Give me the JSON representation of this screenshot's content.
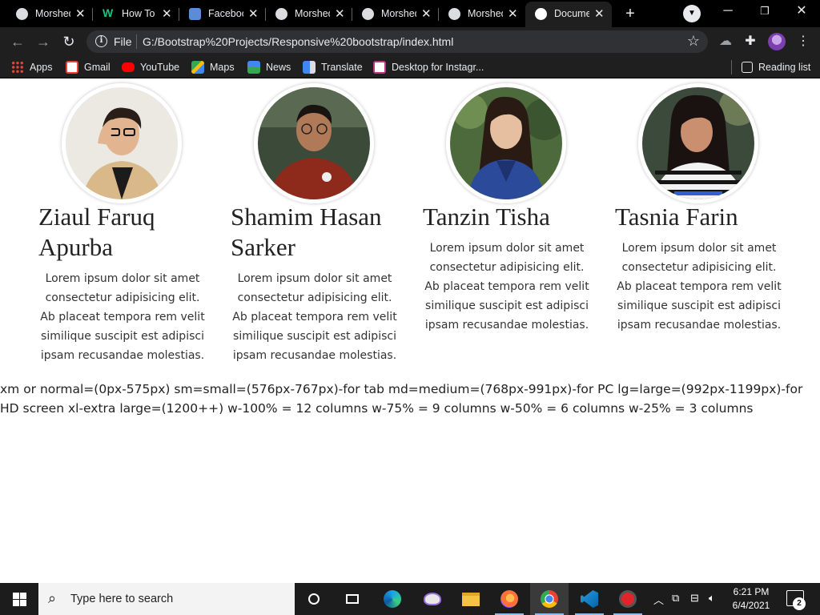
{
  "browser": {
    "tabs": [
      {
        "title": "Morshed",
        "active": false
      },
      {
        "title": "How To",
        "active": false
      },
      {
        "title": "Facebook",
        "active": false
      },
      {
        "title": "Morshed",
        "active": false
      },
      {
        "title": "Morshed",
        "active": false
      },
      {
        "title": "Morshed",
        "active": false
      },
      {
        "title": "Document",
        "active": true
      }
    ],
    "new_tab": "+",
    "address": {
      "scheme_label": "File",
      "url": "G:/Bootstrap%20Projects/Responsive%20bootstrap/index.html"
    },
    "bookmarks": [
      "Apps",
      "Gmail",
      "YouTube",
      "Maps",
      "News",
      "Translate",
      "Desktop for Instagr..."
    ],
    "reading_list": "Reading list"
  },
  "page": {
    "team": [
      {
        "name": "Ziaul Faruq Apurba",
        "description": "Lorem ipsum dolor sit amet consectetur adipisicing elit. Ab placeat tempora rem velit similique suscipit est adipisci ipsam recusandae molestias."
      },
      {
        "name": "Shamim Hasan Sarker",
        "description": "Lorem ipsum dolor sit amet consectetur adipisicing elit. Ab placeat tempora rem velit similique suscipit est adipisci ipsam recusandae molestias."
      },
      {
        "name": "Tanzin Tisha",
        "description": "Lorem ipsum dolor sit amet consectetur adipisicing elit. Ab placeat tempora rem velit similique suscipit est adipisci ipsam recusandae molestias."
      },
      {
        "name": "Tasnia Farin",
        "description": "Lorem ipsum dolor sit amet consectetur adipisicing elit. Ab placeat tempora rem velit similique suscipit est adipisci ipsam recusandae molestias."
      }
    ],
    "breakpoint_note": "xm or normal=(0px-575px) sm=small=(576px-767px)-for tab md=medium=(768px-991px)-for PC lg=large=(992px-1199px)-for HD screen xl-extra large=(1200++) w-100% = 12 columns w-75% = 9 columns w-50% = 6 columns w-25% = 3 columns"
  },
  "taskbar": {
    "search_placeholder": "Type here to search",
    "time": "6:21 PM",
    "date": "6/4/2021",
    "notification_count": "2"
  }
}
